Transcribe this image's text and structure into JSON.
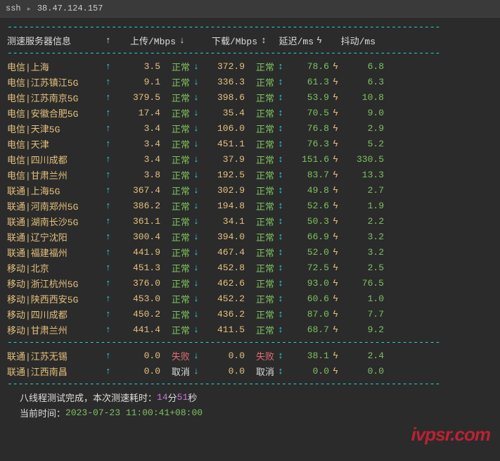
{
  "titlebar": {
    "icon": "▸",
    "label": "ssh",
    "sep": "▸",
    "host": "38.47.124.157"
  },
  "divider": "-------------------------------------------------------------------------------",
  "header": {
    "server_label": "测速服务器信息",
    "up_mark": "↑",
    "up_label": "上传/Mbps",
    "dn_mark": "↓",
    "dn_label": "下载/Mbps",
    "dn_mark2": "↕",
    "lat_label": "延迟/ms",
    "lat_mark": "ϟ",
    "jitter_label": "抖动/ms"
  },
  "rows": [
    {
      "srv": "电信|上海",
      "up": "3.5",
      "ust": "正常",
      "dn": "372.9",
      "dst": "正常",
      "lat": "78.6",
      "jit": "6.8"
    },
    {
      "srv": "电信|江苏镇江5G",
      "up": "9.1",
      "ust": "正常",
      "dn": "336.3",
      "dst": "正常",
      "lat": "61.3",
      "jit": "6.3"
    },
    {
      "srv": "电信|江苏南京5G",
      "up": "379.5",
      "ust": "正常",
      "dn": "398.6",
      "dst": "正常",
      "lat": "53.9",
      "jit": "10.8"
    },
    {
      "srv": "电信|安徽合肥5G",
      "up": "17.4",
      "ust": "正常",
      "dn": "35.4",
      "dst": "正常",
      "lat": "70.5",
      "jit": "9.0"
    },
    {
      "srv": "电信|天津5G",
      "up": "3.4",
      "ust": "正常",
      "dn": "106.0",
      "dst": "正常",
      "lat": "76.8",
      "jit": "2.9"
    },
    {
      "srv": "电信|天津",
      "up": "3.4",
      "ust": "正常",
      "dn": "451.1",
      "dst": "正常",
      "lat": "76.3",
      "jit": "5.2"
    },
    {
      "srv": "电信|四川成都",
      "up": "3.4",
      "ust": "正常",
      "dn": "37.9",
      "dst": "正常",
      "lat": "151.6",
      "jit": "330.5"
    },
    {
      "srv": "电信|甘肃兰州",
      "up": "3.8",
      "ust": "正常",
      "dn": "192.5",
      "dst": "正常",
      "lat": "83.7",
      "jit": "13.3"
    },
    {
      "srv": "联通|上海5G",
      "up": "367.4",
      "ust": "正常",
      "dn": "302.9",
      "dst": "正常",
      "lat": "49.8",
      "jit": "2.7"
    },
    {
      "srv": "联通|河南郑州5G",
      "up": "386.2",
      "ust": "正常",
      "dn": "194.8",
      "dst": "正常",
      "lat": "52.6",
      "jit": "1.9"
    },
    {
      "srv": "联通|湖南长沙5G",
      "up": "361.1",
      "ust": "正常",
      "dn": "34.1",
      "dst": "正常",
      "lat": "50.3",
      "jit": "2.2"
    },
    {
      "srv": "联通|辽宁沈阳",
      "up": "300.4",
      "ust": "正常",
      "dn": "394.0",
      "dst": "正常",
      "lat": "66.9",
      "jit": "3.2"
    },
    {
      "srv": "联通|福建福州",
      "up": "441.9",
      "ust": "正常",
      "dn": "467.4",
      "dst": "正常",
      "lat": "52.0",
      "jit": "3.2"
    },
    {
      "srv": "移动|北京",
      "up": "451.3",
      "ust": "正常",
      "dn": "452.8",
      "dst": "正常",
      "lat": "72.5",
      "jit": "2.5"
    },
    {
      "srv": "移动|浙江杭州5G",
      "up": "376.0",
      "ust": "正常",
      "dn": "462.6",
      "dst": "正常",
      "lat": "93.0",
      "jit": "76.5"
    },
    {
      "srv": "移动|陕西西安5G",
      "up": "453.0",
      "ust": "正常",
      "dn": "452.2",
      "dst": "正常",
      "lat": "60.6",
      "jit": "1.0"
    },
    {
      "srv": "移动|四川成都",
      "up": "450.2",
      "ust": "正常",
      "dn": "436.2",
      "dst": "正常",
      "lat": "87.0",
      "jit": "7.7"
    },
    {
      "srv": "移动|甘肃兰州",
      "up": "441.4",
      "ust": "正常",
      "dn": "411.5",
      "dst": "正常",
      "lat": "68.7",
      "jit": "9.2"
    }
  ],
  "failrows": [
    {
      "srv": "联通|江苏无锡",
      "up": "0.0",
      "ust": "失败",
      "ucls": "red",
      "dn": "0.0",
      "dst": "失败",
      "dcls": "red",
      "lat": "38.1",
      "jit": "2.4"
    },
    {
      "srv": "联通|江西南昌",
      "up": "0.0",
      "ust": "取消",
      "ucls": "white",
      "dn": "0.0",
      "dst": "取消",
      "dcls": "white",
      "lat": "0.0",
      "jit": "0.0"
    }
  ],
  "footer": {
    "line1_a": "八线程测试完成，本次测速耗时：",
    "minutes": "14",
    "min_suffix": " 分 ",
    "seconds": "51",
    "sec_suffix": " 秒",
    "line2_a": "当前时间：",
    "timestamp": "2023-07-23 11:00:41+08:00"
  },
  "watermark": "ivpsr.com",
  "marks": {
    "up": "↑",
    "down": "↓",
    "updown": "↕",
    "bolt": "ϟ"
  }
}
